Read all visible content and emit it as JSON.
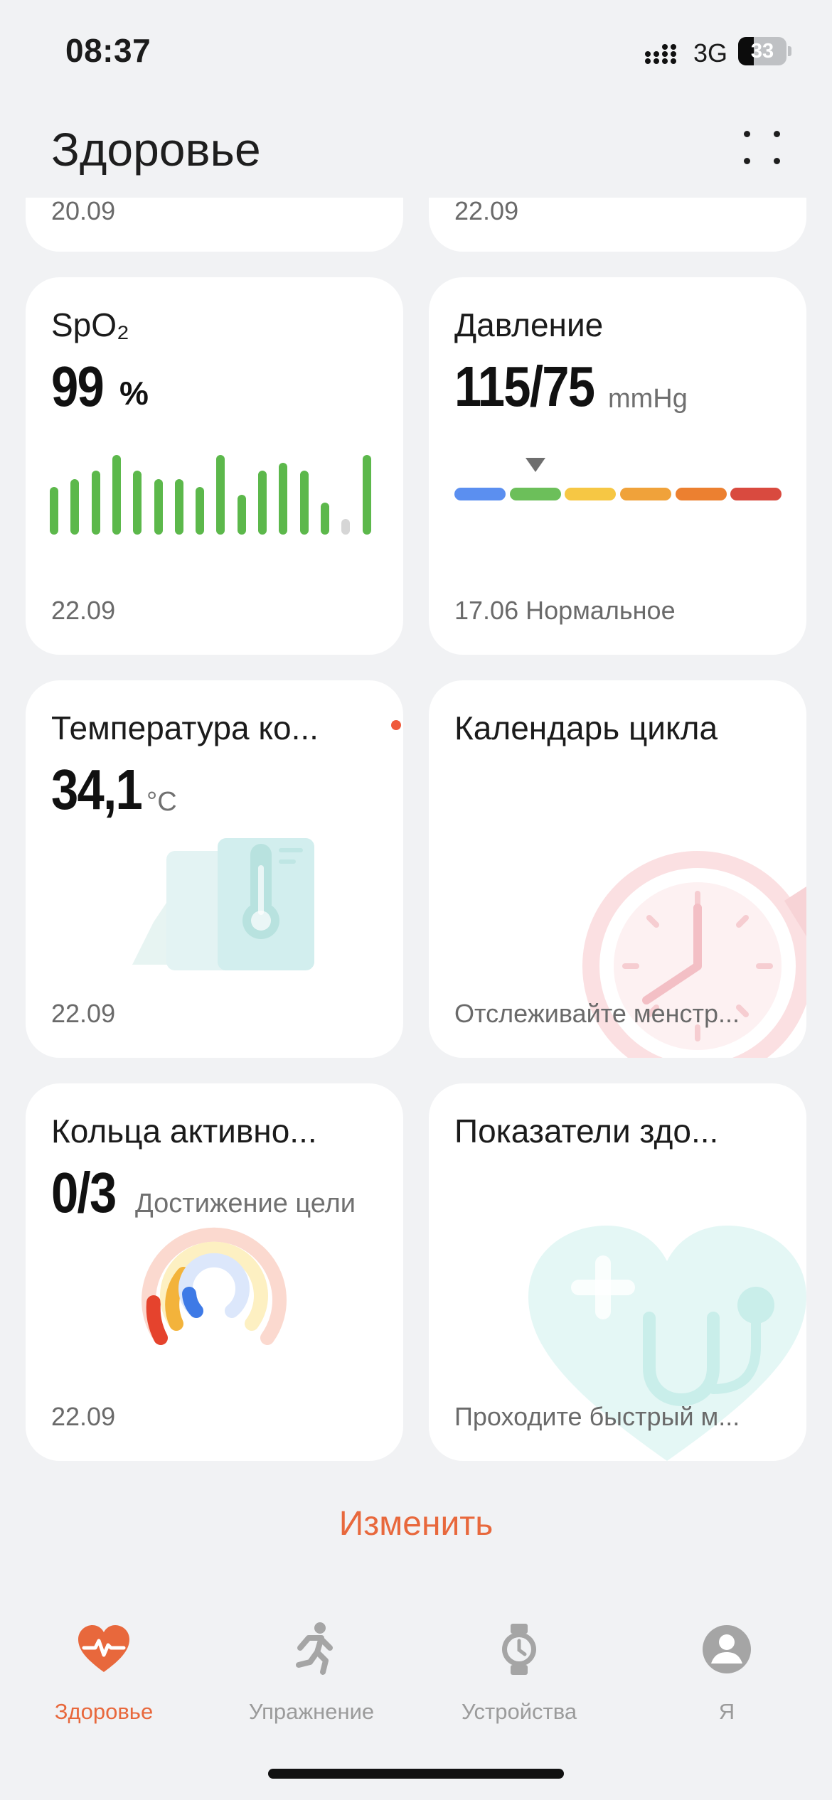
{
  "status_bar": {
    "time": "08:37",
    "network": "3G",
    "battery_level": "33",
    "battery_fraction": 0.33
  },
  "header": {
    "title": "Здоровье"
  },
  "top_cards": [
    {
      "date": "20.09"
    },
    {
      "date": "22.09"
    }
  ],
  "spo2": {
    "title": "SpO₂",
    "value": "99",
    "unit": "%",
    "date": "22.09",
    "bar_levels": [
      0.6,
      0.7,
      0.8,
      1.0,
      0.8,
      0.7,
      0.7,
      0.6,
      1.0,
      0.5,
      0.8,
      0.9,
      0.8,
      0.4,
      0.2,
      1.0
    ],
    "bar_colors": {
      "active": "#5cb84b",
      "inactive": "#d6d6d6"
    }
  },
  "blood_pressure": {
    "title": "Давление",
    "value": "115/75",
    "unit": "mmHg",
    "footer": "17.06 Нормальное",
    "scale_colors": [
      "#5b8ff0",
      "#6cbf5a",
      "#f6c744",
      "#f0a23a",
      "#ec8030",
      "#d94a3f"
    ],
    "current_segment": 1
  },
  "temperature": {
    "title": "Температура ко...",
    "value": "34,1",
    "unit": "°C",
    "date": "22.09",
    "alert_color": "#ef5a3b"
  },
  "cycle_calendar": {
    "title": "Календарь цикла",
    "footer": "Отслеживайте менстр..."
  },
  "activity_rings": {
    "title": "Кольца активно...",
    "value": "0/3",
    "subtitle": "Достижение цели",
    "date": "22.09"
  },
  "health_indicators": {
    "title": "Показатели здо...",
    "footer": "Проходите быстрый м..."
  },
  "edit_button": "Изменить",
  "bottom_nav": [
    {
      "label": "Здоровье",
      "icon": "heart-pulse-icon",
      "active": true
    },
    {
      "label": "Упражнение",
      "icon": "running-icon",
      "active": false
    },
    {
      "label": "Устройства",
      "icon": "watch-icon",
      "active": false
    },
    {
      "label": "Я",
      "icon": "profile-icon",
      "active": false
    }
  ],
  "colors": {
    "accent": "#e8683c",
    "background": "#f1f2f4"
  }
}
